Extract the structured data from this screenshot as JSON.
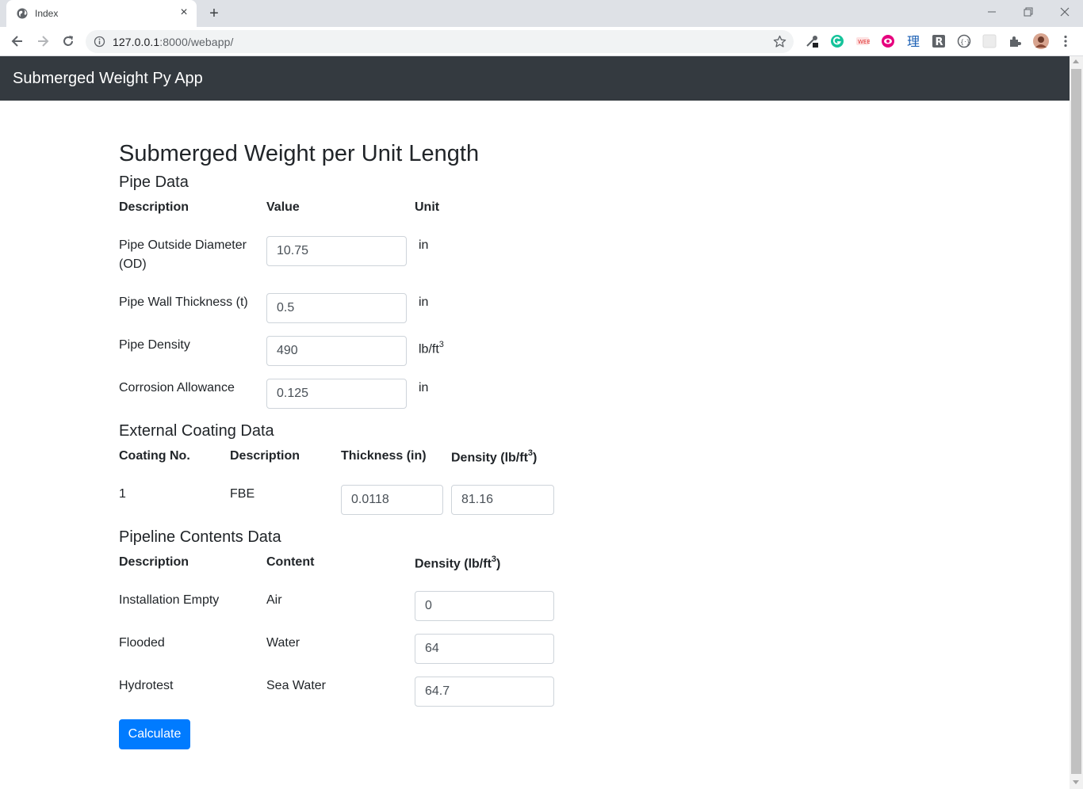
{
  "browser": {
    "tab_title": "Index",
    "url_host": "127.0.0.1",
    "url_rest": ":8000/webapp/"
  },
  "navbar": {
    "brand": "Submerged Weight Py App"
  },
  "page": {
    "title": "Submerged Weight per Unit Length",
    "pipe": {
      "heading": "Pipe Data",
      "headers": [
        "Description",
        "Value",
        "Unit"
      ],
      "rows": [
        {
          "label": "Pipe Outside Diameter (OD)",
          "value": "10.75",
          "unit": "in"
        },
        {
          "label": "Pipe Wall Thickness (t)",
          "value": "0.5",
          "unit": "in"
        },
        {
          "label": "Pipe Density",
          "value": "490",
          "unit": "lb/ft",
          "unit_sup": "3"
        },
        {
          "label": "Corrosion Allowance",
          "value": "0.125",
          "unit": "in"
        }
      ]
    },
    "coating": {
      "heading": "External Coating Data",
      "headers": [
        "Coating No.",
        "Description",
        "Thickness (in)",
        "Density (lb/ft"
      ],
      "header_sup": "3",
      "header_tail": ")",
      "rows": [
        {
          "no": "1",
          "description": "FBE",
          "thickness": "0.0118",
          "density": "81.16"
        }
      ]
    },
    "contents": {
      "heading": "Pipeline Contents Data",
      "headers": [
        "Description",
        "Content",
        "Density (lb/ft"
      ],
      "header_sup": "3",
      "header_tail": ")",
      "rows": [
        {
          "description": "Installation Empty",
          "content": "Air",
          "density": "0"
        },
        {
          "description": "Flooded",
          "content": "Water",
          "density": "64"
        },
        {
          "description": "Hydrotest",
          "content": "Sea Water",
          "density": "64.7"
        }
      ]
    },
    "calculate_label": "Calculate"
  },
  "colors": {
    "navbar": "#343a40",
    "primary": "#007bff"
  },
  "icons": [
    "globe-icon",
    "close-icon",
    "plus-icon",
    "back-icon",
    "forward-icon",
    "reload-icon",
    "info-icon",
    "star-icon",
    "extensions-icon",
    "menu-icon"
  ]
}
